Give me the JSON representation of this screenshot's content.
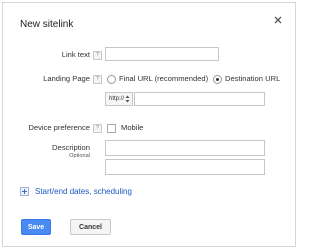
{
  "dialog": {
    "title": "New sitelink",
    "close_icon": "close-icon"
  },
  "form": {
    "link_text": {
      "label": "Link text",
      "help": "?",
      "value": ""
    },
    "landing_page": {
      "label": "Landing Page",
      "help": "?",
      "options": [
        {
          "label": "Final URL (recommended)",
          "selected": false
        },
        {
          "label": "Destination URL",
          "selected": true
        }
      ],
      "protocol": "http://",
      "url_value": ""
    },
    "device_preference": {
      "label": "Device preference",
      "help": "?",
      "option_label": "Mobile",
      "checked": false
    },
    "description": {
      "label": "Description",
      "sub_label": "Optional",
      "line1": "",
      "line2": ""
    }
  },
  "expander": {
    "label": "Start/end dates, scheduling",
    "icon": "plus-box-icon"
  },
  "buttons": {
    "save": "Save",
    "cancel": "Cancel"
  },
  "colors": {
    "primary": "#4a8af4",
    "link": "#1a57c4",
    "border": "#c7c7c7"
  }
}
